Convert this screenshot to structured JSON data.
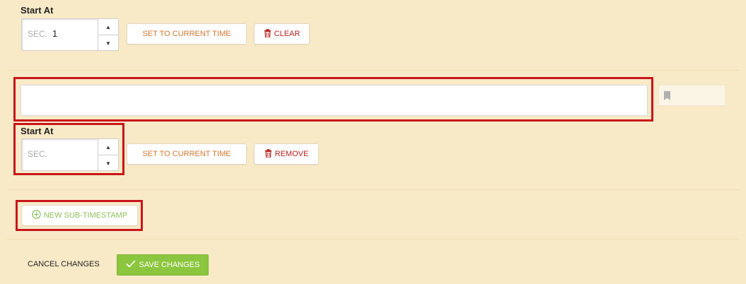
{
  "timestamp": {
    "start_label": "Start At",
    "sec_placeholder": "SEC.",
    "sec_value": "1",
    "set_current_label": "SET TO CURRENT TIME",
    "clear_label": "CLEAR"
  },
  "sub_timestamp": {
    "title_value": "",
    "start_label": "Start At",
    "sec_placeholder": "SEC.",
    "sec_value": "",
    "set_current_label": "SET TO CURRENT TIME",
    "remove_label": "REMOVE",
    "bookmark_icon": "bookmark-icon"
  },
  "new_sub_label": "NEW SUB-TIMESTAMP",
  "footer": {
    "cancel_label": "CANCEL CHANGES",
    "save_label": "SAVE CHANGES"
  },
  "colors": {
    "background": "#f8eac7",
    "highlight": "#c8151b",
    "orange": "#d3782f",
    "red": "#b5221d",
    "green": "#8cc63f"
  }
}
